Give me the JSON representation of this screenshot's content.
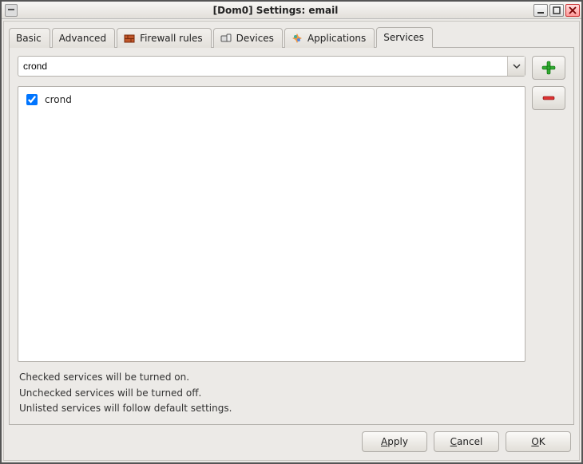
{
  "window": {
    "title": "[Dom0] Settings: email"
  },
  "tabs": {
    "basic": "Basic",
    "advanced": "Advanced",
    "firewall": "Firewall rules",
    "devices": "Devices",
    "applications": "Applications",
    "services": "Services",
    "active": "services"
  },
  "services": {
    "combo_value": "crond",
    "items": [
      {
        "label": "crond",
        "checked": true
      }
    ]
  },
  "hints": {
    "checked": "Checked services will be turned on.",
    "unchecked": "Unchecked services will be turned off.",
    "unlisted": "Unlisted services will follow default settings."
  },
  "buttons": {
    "apply": "Apply",
    "cancel": "Cancel",
    "ok": "OK"
  }
}
